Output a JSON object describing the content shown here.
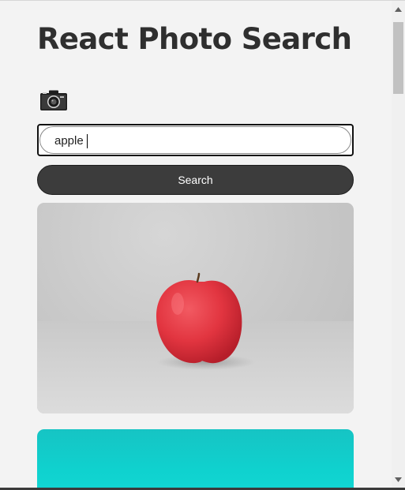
{
  "header": {
    "title": "React Photo Search"
  },
  "search": {
    "value": "apple",
    "button_label": "Search"
  },
  "icons": {
    "camera": "camera-icon",
    "scroll_up": "scroll-up-arrow-icon",
    "scroll_down": "scroll-down-arrow-icon"
  },
  "results": [
    {
      "description": "red apple on gray background"
    },
    {
      "description": "turquoise image"
    }
  ],
  "colors": {
    "background": "#f3f3f3",
    "button": "#3c3c3c",
    "title": "#2f2f2f",
    "apple_red": "#e0323c",
    "teal": "#0fd2cf"
  }
}
